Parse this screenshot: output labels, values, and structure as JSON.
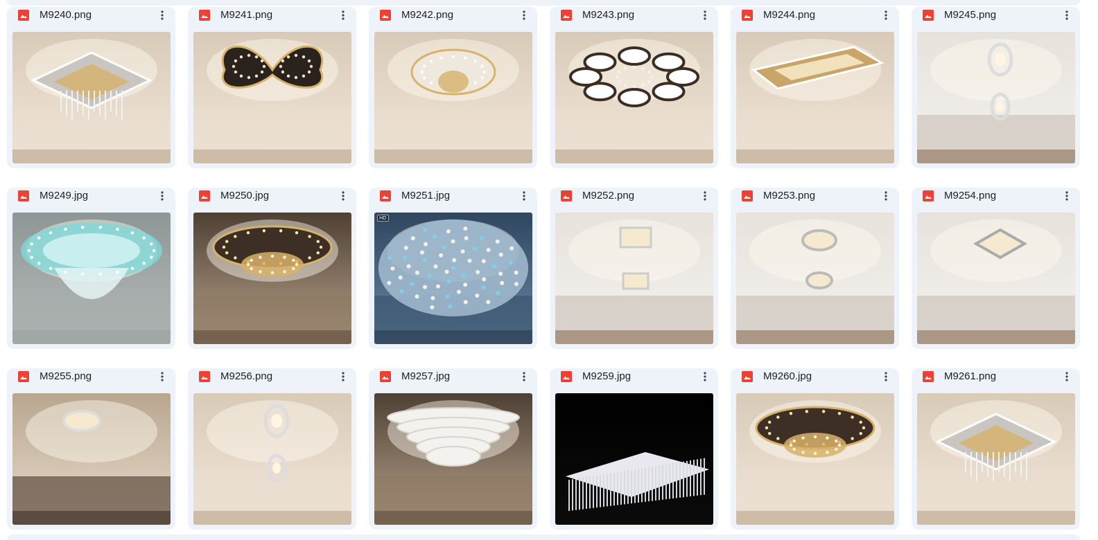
{
  "colors": {
    "card_background": "#eef2f9",
    "image_icon": "#ea4335",
    "text": "#1f1f1f"
  },
  "icons": {
    "file_type": "image-file-icon",
    "menu": "more-vertical-icon"
  },
  "files": [
    {
      "name": "M9240.png",
      "scene": "warm",
      "style": "square"
    },
    {
      "name": "M9241.png",
      "scene": "warm",
      "style": "butterfly"
    },
    {
      "name": "M9242.png",
      "scene": "warm",
      "style": "round"
    },
    {
      "name": "M9243.png",
      "scene": "warm",
      "style": "hearts"
    },
    {
      "name": "M9244.png",
      "scene": "warm",
      "style": "rect"
    },
    {
      "name": "M9245.png",
      "scene": "corridor",
      "style": "rings2"
    },
    {
      "name": "M9249.jpg",
      "scene": "grey",
      "style": "blue-crystal"
    },
    {
      "name": "M9250.jpg",
      "scene": "dark",
      "style": "gold-flower"
    },
    {
      "name": "M9251.jpg",
      "scene": "night",
      "style": "crystal-dome",
      "badge": "HD"
    },
    {
      "name": "M9252.png",
      "scene": "corridor",
      "style": "squares2"
    },
    {
      "name": "M9253.png",
      "scene": "corridor",
      "style": "rounds2"
    },
    {
      "name": "M9254.png",
      "scene": "corridor",
      "style": "square1"
    },
    {
      "name": "M9255.png",
      "scene": "closet",
      "style": "ring1"
    },
    {
      "name": "M9256.png",
      "scene": "warm",
      "style": "rings2"
    },
    {
      "name": "M9257.jpg",
      "scene": "dark",
      "style": "tiered"
    },
    {
      "name": "M9259.jpg",
      "scene": "black",
      "style": "rect-crystal"
    },
    {
      "name": "M9260.jpg",
      "scene": "warm",
      "style": "gold-flower"
    },
    {
      "name": "M9261.png",
      "scene": "warm",
      "style": "square"
    }
  ]
}
